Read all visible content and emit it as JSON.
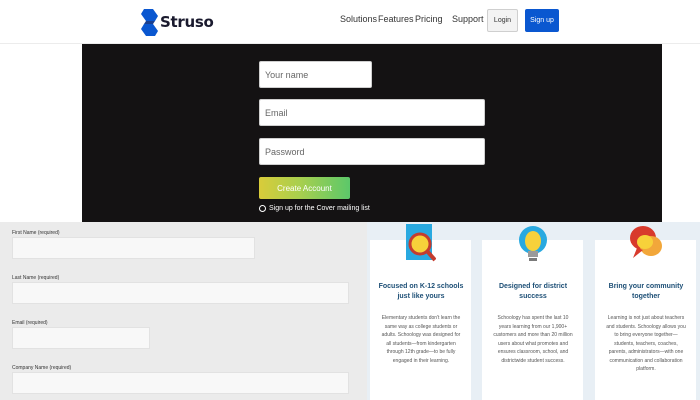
{
  "brand": {
    "name": "Struso",
    "logo_color": "#0a57d0"
  },
  "nav": {
    "links": [
      "Solutions",
      "Features",
      "Pricing",
      "Support"
    ],
    "login_label": "Login",
    "signup_label": "Sign up"
  },
  "signup_form": {
    "name_placeholder": "Your name",
    "email_placeholder": "Email",
    "password_placeholder": "Password",
    "create_button": "Create Account",
    "mailing_list_label": "Sign up for the Cover mailing list"
  },
  "lead_form": {
    "first_name_label": "First Name (required)",
    "last_name_label": "Last Name (required)",
    "email_label": "Email (required)",
    "company_label": "Company Name (required)"
  },
  "features": [
    {
      "icon": "magnifier-icon",
      "title": "Focused on K-12 schools just like yours",
      "text": "Elementary students don't learn the same way as college students or adults. Schoology was designed for all students—from kindergarten through 12th grade—to be fully engaged in their learning."
    },
    {
      "icon": "lightbulb-icon",
      "title": "Designed for district success",
      "text": "Schoology has spent the last 10 years learning from our 1,900+ customers and more than 20 million users about what promotes and ensures classroom, school, and districtwide student success."
    },
    {
      "icon": "chat-bubbles-icon",
      "title": "Bring your community together",
      "text": "Learning is not just about teachers and students. Schoology allows you to bring everyone together—students, teachers, coaches, parents, administrators—with one communication and collaboration platform."
    }
  ]
}
